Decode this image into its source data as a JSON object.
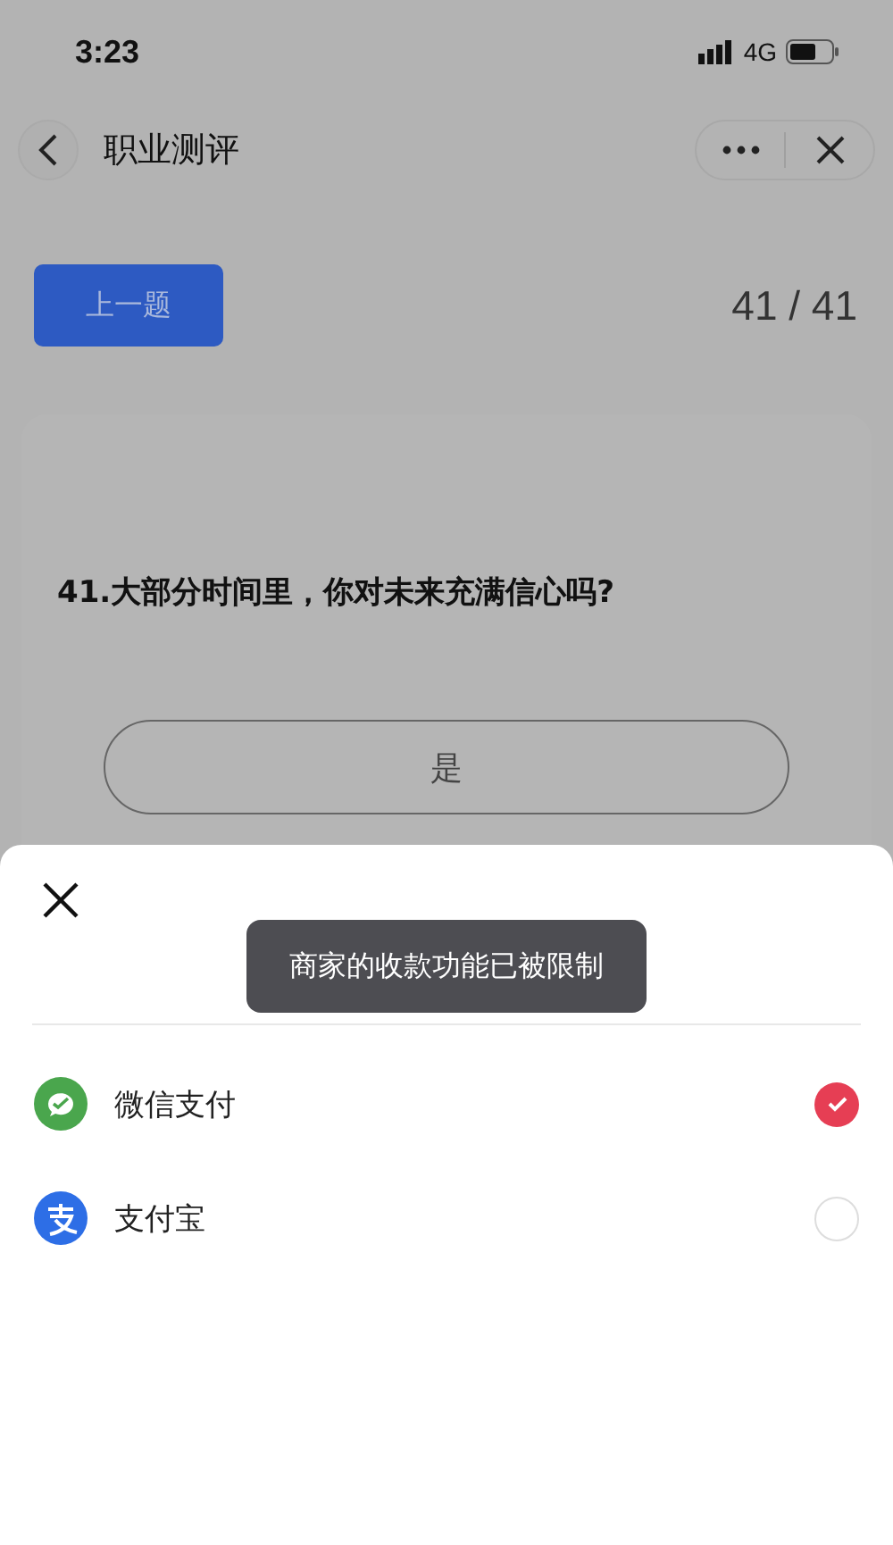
{
  "status_bar": {
    "time": "3:23",
    "network": "4G"
  },
  "nav_bar": {
    "title": "职业测评"
  },
  "quiz": {
    "prev_button": "上一题",
    "progress": "41 / 41",
    "question": "41.大部分时间里，你对未来充满信心吗?",
    "options": [
      {
        "label": "是"
      }
    ]
  },
  "payment_sheet": {
    "toast": "商家的收款功能已被限制",
    "methods": [
      {
        "name": "微信支付",
        "kind": "wechat",
        "selected": true
      },
      {
        "name": "支付宝",
        "kind": "alipay",
        "selected": false
      }
    ]
  }
}
